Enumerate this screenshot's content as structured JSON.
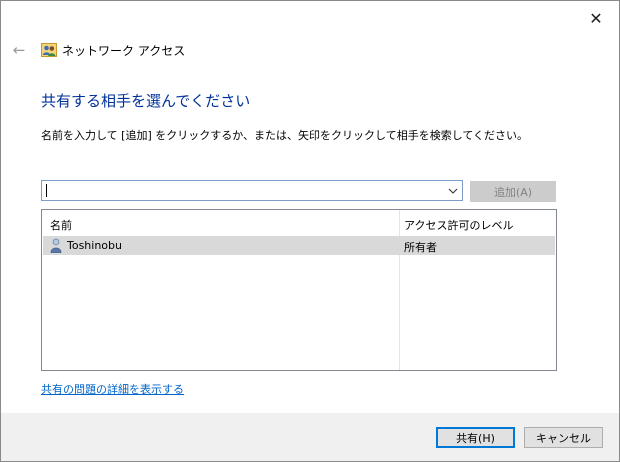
{
  "window": {
    "title": "ネットワーク アクセス",
    "close_glyph": "✕",
    "back_glyph": "←"
  },
  "heading": "共有する相手を選んでください",
  "instruction": "名前を入力して [追加] をクリックするか、または、矢印をクリックして相手を検索してください。",
  "combo": {
    "value": ""
  },
  "add_button": "追加(A)",
  "list": {
    "columns": [
      "名前",
      "アクセス許可のレベル"
    ],
    "rows": [
      {
        "name": "Toshinobu",
        "permission": "所有者",
        "selected": true
      }
    ]
  },
  "link": "共有の問題の詳細を表示する",
  "footer": {
    "share_label": "共有(H)",
    "cancel_label": "キャンセル"
  },
  "colors": {
    "heading": "#003399",
    "link": "#0066cc",
    "selected_row": "#d9d9d9",
    "primary_border": "#0078d7"
  },
  "icons": [
    "back-arrow-icon",
    "network-users-icon",
    "close-icon",
    "chevron-down-icon",
    "user-icon"
  ]
}
